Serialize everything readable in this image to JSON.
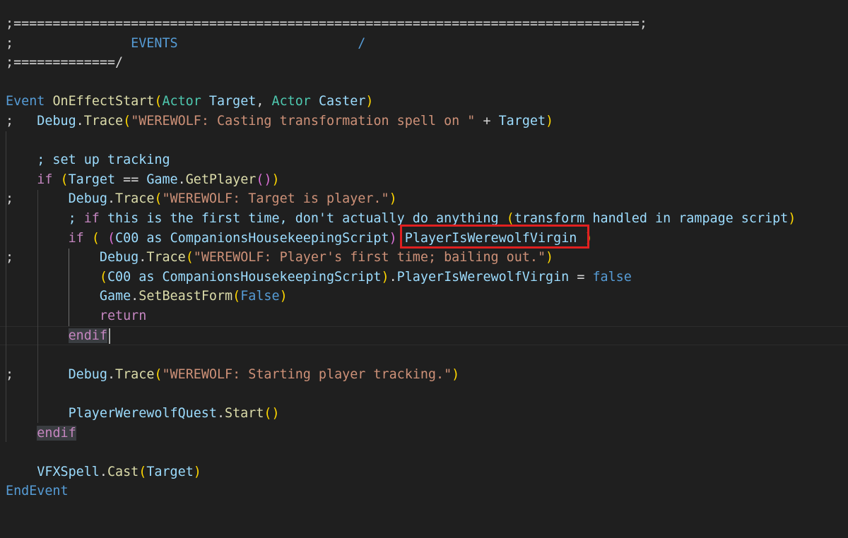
{
  "editor": {
    "lines": [
      {
        "tokens": [
          {
            "text": ";================================================================================;",
            "style": "hdr"
          }
        ]
      },
      {
        "tokens": [
          {
            "text": ";",
            "style": "hdr"
          },
          {
            "text": "               EVENTS",
            "style": "kw"
          },
          {
            "text": "                       /",
            "style": "kw"
          }
        ]
      },
      {
        "tokens": [
          {
            "text": ";=============/",
            "style": "hdr"
          }
        ]
      },
      {
        "tokens": []
      },
      {
        "tokens": [
          {
            "text": "Event",
            "style": "kw"
          },
          {
            "text": " ",
            "style": "pn"
          },
          {
            "text": "OnEffectStart",
            "style": "fn"
          },
          {
            "text": "(",
            "style": "pr"
          },
          {
            "text": "Actor",
            "style": "ty"
          },
          {
            "text": " ",
            "style": "pn"
          },
          {
            "text": "Target",
            "style": "id"
          },
          {
            "text": ", ",
            "style": "pn"
          },
          {
            "text": "Actor",
            "style": "ty"
          },
          {
            "text": " ",
            "style": "pn"
          },
          {
            "text": "Caster",
            "style": "id"
          },
          {
            "text": ")",
            "style": "pr"
          }
        ]
      },
      {
        "tokens": [
          {
            "text": ";   ",
            "style": "pn"
          },
          {
            "text": "Debug",
            "style": "id"
          },
          {
            "text": ".",
            "style": "pn"
          },
          {
            "text": "Trace",
            "style": "fn"
          },
          {
            "text": "(",
            "style": "pr"
          },
          {
            "text": "\"WEREWOLF: Casting transformation spell on \"",
            "style": "st"
          },
          {
            "text": " + ",
            "style": "pn"
          },
          {
            "text": "Target",
            "style": "id"
          },
          {
            "text": ")",
            "style": "pr"
          }
        ]
      },
      {
        "tokens": []
      },
      {
        "tokens": [
          {
            "text": "    ; set up tracking",
            "style": "id"
          }
        ]
      },
      {
        "tokens": [
          {
            "text": "    ",
            "style": "pn"
          },
          {
            "text": "if",
            "style": "ctl"
          },
          {
            "text": " ",
            "style": "pn"
          },
          {
            "text": "(",
            "style": "pr"
          },
          {
            "text": "Target",
            "style": "id"
          },
          {
            "text": " == ",
            "style": "pn"
          },
          {
            "text": "Game",
            "style": "id"
          },
          {
            "text": ".",
            "style": "pn"
          },
          {
            "text": "GetPlayer",
            "style": "fn"
          },
          {
            "text": "()",
            "style": "pr2"
          },
          {
            "text": ")",
            "style": "pr"
          }
        ]
      },
      {
        "tokens": [
          {
            "text": ";       ",
            "style": "pn"
          },
          {
            "text": "Debug",
            "style": "id"
          },
          {
            "text": ".",
            "style": "pn"
          },
          {
            "text": "Trace",
            "style": "fn"
          },
          {
            "text": "(",
            "style": "pr"
          },
          {
            "text": "\"WEREWOLF: Target is player.\"",
            "style": "st"
          },
          {
            "text": ")",
            "style": "pr"
          }
        ]
      },
      {
        "tokens": [
          {
            "text": "        ; ",
            "style": "id"
          },
          {
            "text": "if",
            "style": "ctl"
          },
          {
            "text": " this is the first time, don't actually do anything ",
            "style": "id"
          },
          {
            "text": "(",
            "style": "pr"
          },
          {
            "text": "transform handled in rampage script",
            "style": "id"
          },
          {
            "text": ")",
            "style": "pr"
          }
        ]
      },
      {
        "tokens": [
          {
            "text": "        ",
            "style": "pn"
          },
          {
            "text": "if",
            "style": "ctl"
          },
          {
            "text": " ",
            "style": "pn"
          },
          {
            "text": "(",
            "style": "pr"
          },
          {
            "text": " ",
            "style": "pn"
          },
          {
            "text": "(",
            "style": "pr2"
          },
          {
            "text": "C00",
            "style": "id"
          },
          {
            "text": " as ",
            "style": "id"
          },
          {
            "text": "CompanionsHousekeepingScript",
            "style": "id"
          },
          {
            "text": ")",
            "style": "pr2"
          },
          {
            "text": ".",
            "style": "pn"
          },
          {
            "text": "PlayerIsWerewolfVirgin",
            "style": "id"
          },
          {
            "text": " ",
            "style": "pn"
          },
          {
            "text": ")",
            "style": "pr"
          }
        ]
      },
      {
        "tokens": [
          {
            "text": ";           ",
            "style": "pn"
          },
          {
            "text": "Debug",
            "style": "id"
          },
          {
            "text": ".",
            "style": "pn"
          },
          {
            "text": "Trace",
            "style": "fn"
          },
          {
            "text": "(",
            "style": "pr"
          },
          {
            "text": "\"WEREWOLF: Player's first time; bailing out.\"",
            "style": "st"
          },
          {
            "text": ")",
            "style": "pr"
          }
        ]
      },
      {
        "tokens": [
          {
            "text": "            ",
            "style": "pn"
          },
          {
            "text": "(",
            "style": "pr"
          },
          {
            "text": "C00",
            "style": "id"
          },
          {
            "text": " as ",
            "style": "id"
          },
          {
            "text": "CompanionsHousekeepingScript",
            "style": "id"
          },
          {
            "text": ")",
            "style": "pr"
          },
          {
            "text": ".",
            "style": "pn"
          },
          {
            "text": "PlayerIsWerewolfVirgin",
            "style": "id"
          },
          {
            "text": " = ",
            "style": "pn"
          },
          {
            "text": "false",
            "style": "kw"
          }
        ]
      },
      {
        "tokens": [
          {
            "text": "            ",
            "style": "pn"
          },
          {
            "text": "Game",
            "style": "id"
          },
          {
            "text": ".",
            "style": "pn"
          },
          {
            "text": "SetBeastForm",
            "style": "fn"
          },
          {
            "text": "(",
            "style": "pr"
          },
          {
            "text": "False",
            "style": "kw"
          },
          {
            "text": ")",
            "style": "pr"
          }
        ]
      },
      {
        "tokens": [
          {
            "text": "            ",
            "style": "pn"
          },
          {
            "text": "return",
            "style": "ctl"
          }
        ]
      },
      {
        "tokens": [
          {
            "text": "        ",
            "style": "pn"
          },
          {
            "text": "endif",
            "style": "hl"
          }
        ]
      },
      {
        "tokens": []
      },
      {
        "tokens": [
          {
            "text": ";       ",
            "style": "pn"
          },
          {
            "text": "Debug",
            "style": "id"
          },
          {
            "text": ".",
            "style": "pn"
          },
          {
            "text": "Trace",
            "style": "fn"
          },
          {
            "text": "(",
            "style": "pr"
          },
          {
            "text": "\"WEREWOLF: Starting player tracking.\"",
            "style": "st"
          },
          {
            "text": ")",
            "style": "pr"
          }
        ]
      },
      {
        "tokens": []
      },
      {
        "tokens": [
          {
            "text": "        ",
            "style": "pn"
          },
          {
            "text": "PlayerWerewolfQuest",
            "style": "id"
          },
          {
            "text": ".",
            "style": "pn"
          },
          {
            "text": "Start",
            "style": "fn"
          },
          {
            "text": "()",
            "style": "pr"
          }
        ]
      },
      {
        "tokens": [
          {
            "text": "    ",
            "style": "pn"
          },
          {
            "text": "endif",
            "style": "hl"
          }
        ]
      },
      {
        "tokens": []
      },
      {
        "tokens": [
          {
            "text": "    ",
            "style": "pn"
          },
          {
            "text": "VFXSpell",
            "style": "id"
          },
          {
            "text": ".",
            "style": "pn"
          },
          {
            "text": "Cast",
            "style": "fn"
          },
          {
            "text": "(",
            "style": "pr"
          },
          {
            "text": "Target",
            "style": "id"
          },
          {
            "text": ")",
            "style": "pr"
          }
        ]
      },
      {
        "tokens": [
          {
            "text": "EndEvent",
            "style": "kw"
          }
        ]
      }
    ]
  },
  "theme": {
    "background": "#1f1f1f",
    "annotation_color": "#e02020"
  },
  "annotation": {
    "highlighted_text": "PlayerIsWerewolfVirgin"
  }
}
